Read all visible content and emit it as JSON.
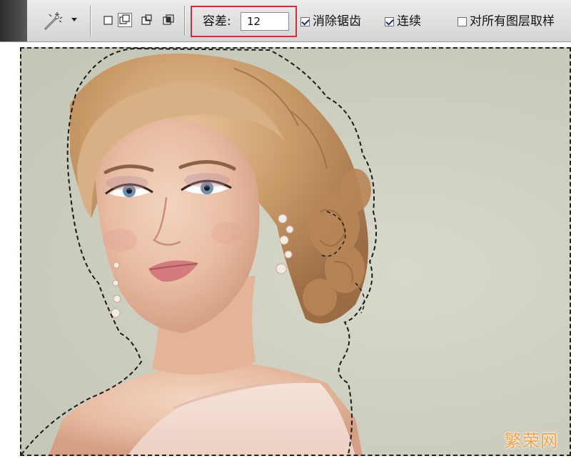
{
  "toolbar": {
    "tool_icon": "magic-wand-icon",
    "selection_modes": [
      "new-selection-icon",
      "add-to-selection-icon",
      "subtract-from-selection-icon",
      "intersect-selection-icon"
    ],
    "tolerance_label": "容差:",
    "tolerance_value": "12",
    "anti_alias_label": "消除锯齿",
    "anti_alias_checked": true,
    "contiguous_label": "连续",
    "contiguous_checked": true,
    "sample_all_layers_label": "对所有图层取样",
    "sample_all_layers_checked": false,
    "highlight_color": "#c8323a"
  },
  "canvas": {
    "background_color": "#cfd0c2",
    "selection_style": "marching-ants"
  },
  "watermark": {
    "text": "繁荣网",
    "color": "#f0a24a"
  }
}
